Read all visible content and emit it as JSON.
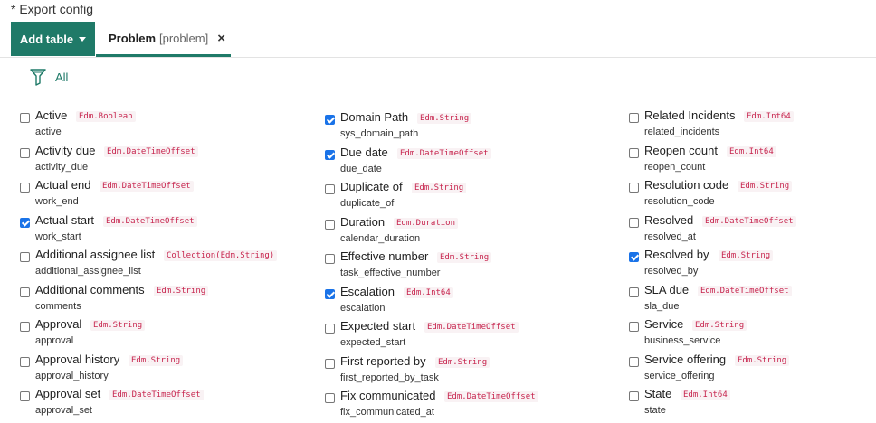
{
  "header": {
    "title": "* Export config"
  },
  "toolbar": {
    "add_table_label": "Add table"
  },
  "tab": {
    "name": "Problem",
    "key": "[problem]",
    "close": "×"
  },
  "filter": {
    "label": "All"
  },
  "columns": [
    [
      {
        "label": "Active",
        "type": "Edm.Boolean",
        "key": "active",
        "checked": false
      },
      {
        "label": "Activity due",
        "type": "Edm.DateTimeOffset",
        "key": "activity_due",
        "checked": false
      },
      {
        "label": "Actual end",
        "type": "Edm.DateTimeOffset",
        "key": "work_end",
        "checked": false
      },
      {
        "label": "Actual start",
        "type": "Edm.DateTimeOffset",
        "key": "work_start",
        "checked": true
      },
      {
        "label": "Additional assignee list",
        "type": "Collection(Edm.String)",
        "key": "additional_assignee_list",
        "checked": false
      },
      {
        "label": "Additional comments",
        "type": "Edm.String",
        "key": "comments",
        "checked": false
      },
      {
        "label": "Approval",
        "type": "Edm.String",
        "key": "approval",
        "checked": false
      },
      {
        "label": "Approval history",
        "type": "Edm.String",
        "key": "approval_history",
        "checked": false
      },
      {
        "label": "Approval set",
        "type": "Edm.DateTimeOffset",
        "key": "approval_set",
        "checked": false
      }
    ],
    [
      {
        "label": "Domain Path",
        "type": "Edm.String",
        "key": "sys_domain_path",
        "checked": true
      },
      {
        "label": "Due date",
        "type": "Edm.DateTimeOffset",
        "key": "due_date",
        "checked": true
      },
      {
        "label": "Duplicate of",
        "type": "Edm.String",
        "key": "duplicate_of",
        "checked": false
      },
      {
        "label": "Duration",
        "type": "Edm.Duration",
        "key": "calendar_duration",
        "checked": false
      },
      {
        "label": "Effective number",
        "type": "Edm.String",
        "key": "task_effective_number",
        "checked": false
      },
      {
        "label": "Escalation",
        "type": "Edm.Int64",
        "key": "escalation",
        "checked": true
      },
      {
        "label": "Expected start",
        "type": "Edm.DateTimeOffset",
        "key": "expected_start",
        "checked": false
      },
      {
        "label": "First reported by",
        "type": "Edm.String",
        "key": "first_reported_by_task",
        "checked": false
      },
      {
        "label": "Fix communicated",
        "type": "Edm.DateTimeOffset",
        "key": "fix_communicated_at",
        "checked": false
      }
    ],
    [
      {
        "label": "Related Incidents",
        "type": "Edm.Int64",
        "key": "related_incidents",
        "checked": false
      },
      {
        "label": "Reopen count",
        "type": "Edm.Int64",
        "key": "reopen_count",
        "checked": false
      },
      {
        "label": "Resolution code",
        "type": "Edm.String",
        "key": "resolution_code",
        "checked": false
      },
      {
        "label": "Resolved",
        "type": "Edm.DateTimeOffset",
        "key": "resolved_at",
        "checked": false
      },
      {
        "label": "Resolved by",
        "type": "Edm.String",
        "key": "resolved_by",
        "checked": true
      },
      {
        "label": "SLA due",
        "type": "Edm.DateTimeOffset",
        "key": "sla_due",
        "checked": false
      },
      {
        "label": "Service",
        "type": "Edm.String",
        "key": "business_service",
        "checked": false
      },
      {
        "label": "Service offering",
        "type": "Edm.String",
        "key": "service_offering",
        "checked": false
      },
      {
        "label": "State",
        "type": "Edm.Int64",
        "key": "state",
        "checked": false
      }
    ]
  ],
  "colors": {
    "accent": "#1f7a68",
    "checkbox": "#1a73e8",
    "type_text": "#c7254e"
  }
}
